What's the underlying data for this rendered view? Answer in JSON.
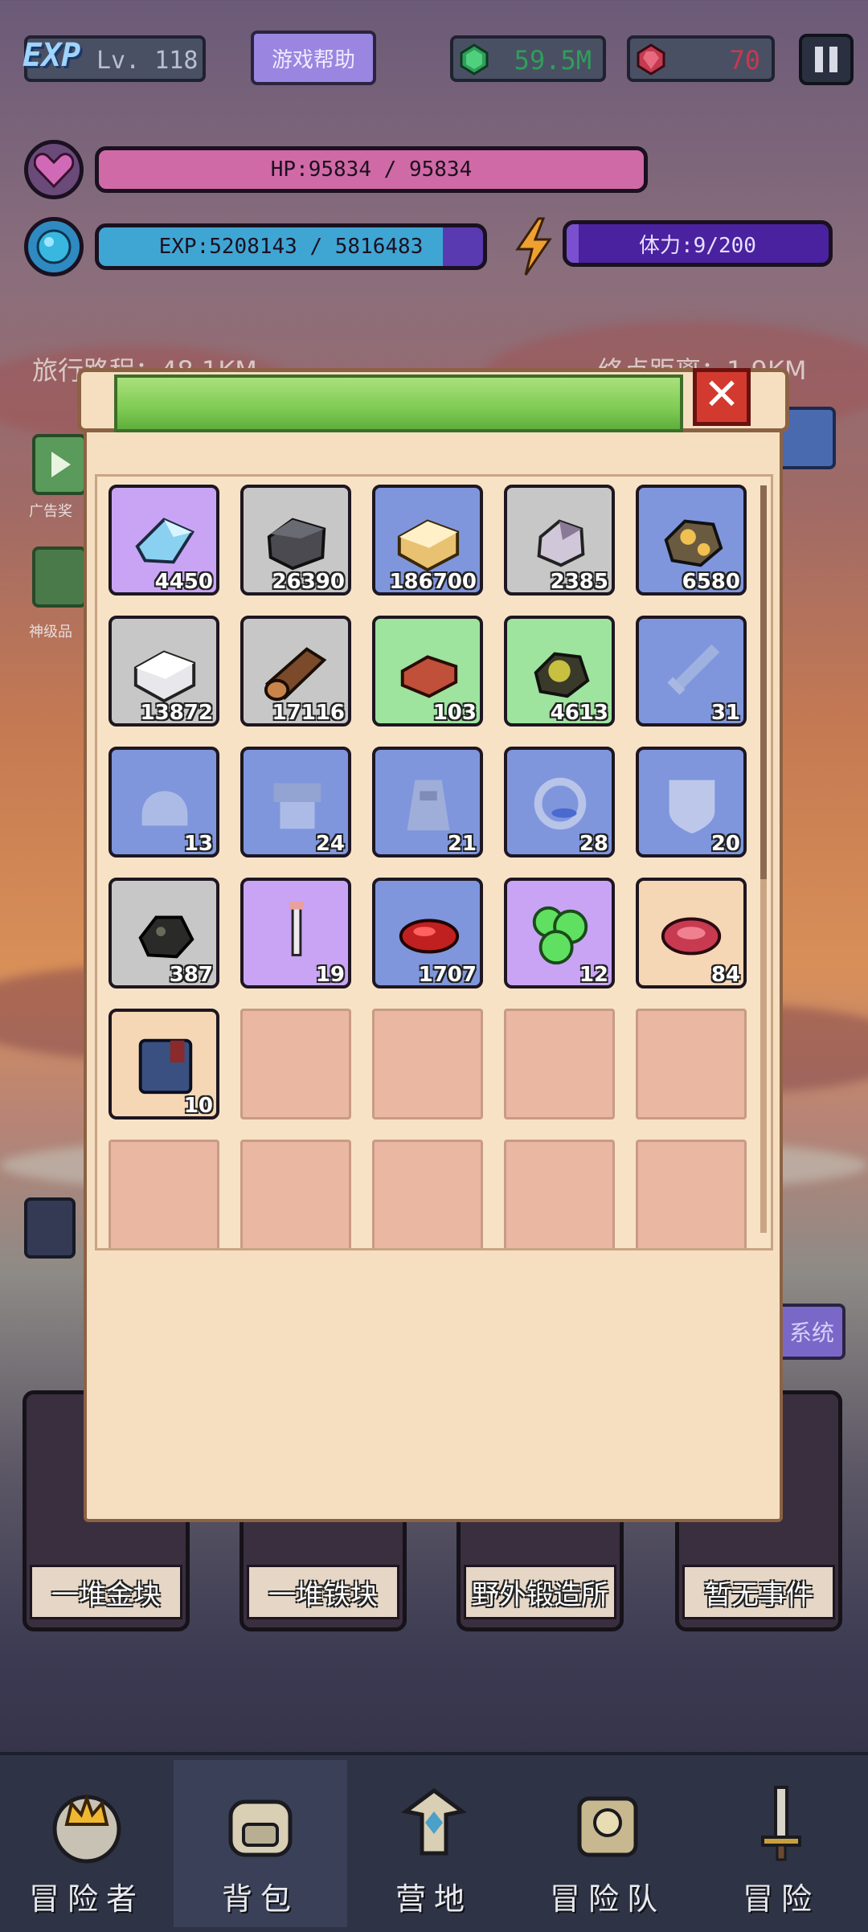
{
  "header": {
    "exp_logo": "EXP",
    "level": "Lv. 118",
    "help_button": "游戏帮助",
    "currency_green": "59.5M",
    "currency_red": "70",
    "green_color": "#2f9e5a",
    "red_color": "#c43a4f"
  },
  "stats": {
    "hp_text": "HP:95834 / 95834",
    "hp_fraction": 1.0,
    "exp_text": "EXP:5208143 / 5816483",
    "exp_fraction": 0.895,
    "stamina_text": "体力:9/200",
    "stamina_fraction": 0.045
  },
  "background": {
    "travel_distance": "旅行路程：48.1KM",
    "end_distance": "终点距离：1.9KM",
    "ad_reward": "广告奖",
    "divine_item": "神级品",
    "system_button": "系统"
  },
  "inventory": {
    "title": "",
    "items": [
      {
        "icon": "crystal-icon",
        "count": "4450",
        "rarity": "#c9a4f5"
      },
      {
        "icon": "iron-ore-icon",
        "count": "26390",
        "rarity": "#c7c7c7"
      },
      {
        "icon": "gold-ingot-icon",
        "count": "186700",
        "rarity": "#7f96dd"
      },
      {
        "icon": "silver-ore-icon",
        "count": "2385",
        "rarity": "#c7c7c7"
      },
      {
        "icon": "gold-ore-icon",
        "count": "6580",
        "rarity": "#7f96dd"
      },
      {
        "icon": "stone-block-icon",
        "count": "13872",
        "rarity": "#c7c7c7"
      },
      {
        "icon": "wood-log-icon",
        "count": "17116",
        "rarity": "#c7c7c7"
      },
      {
        "icon": "brick-icon",
        "count": "103",
        "rarity": "#9ee39e"
      },
      {
        "icon": "sulfur-ore-icon",
        "count": "4613",
        "rarity": "#9ee39e"
      },
      {
        "icon": "sword-blueprint-icon",
        "count": "31",
        "rarity": "#7f96dd"
      },
      {
        "icon": "helmet-blueprint-icon",
        "count": "13",
        "rarity": "#7f96dd"
      },
      {
        "icon": "armor-blueprint-icon",
        "count": "24",
        "rarity": "#7f96dd"
      },
      {
        "icon": "robe-blueprint-icon",
        "count": "21",
        "rarity": "#7f96dd"
      },
      {
        "icon": "ring-blueprint-icon",
        "count": "28",
        "rarity": "#7f96dd"
      },
      {
        "icon": "shield-blueprint-icon",
        "count": "20",
        "rarity": "#7f96dd"
      },
      {
        "icon": "coal-icon",
        "count": "387",
        "rarity": "#c7c7c7"
      },
      {
        "icon": "wand-icon",
        "count": "19",
        "rarity": "#c9a4f5"
      },
      {
        "icon": "red-lens-icon",
        "count": "1707",
        "rarity": "#7f96dd"
      },
      {
        "icon": "slime-icon",
        "count": "12",
        "rarity": "#c9a4f5"
      },
      {
        "icon": "meat-icon",
        "count": "84",
        "rarity": "#f5d7b6"
      },
      {
        "icon": "book-icon",
        "count": "10",
        "rarity": "#f5d7b6"
      }
    ],
    "empty_slots": 9
  },
  "events": [
    {
      "label": "一堆金块"
    },
    {
      "label": "一堆铁块"
    },
    {
      "label": "野外锻造所"
    },
    {
      "label": "暂无事件"
    }
  ],
  "nav": [
    {
      "label": "冒险者",
      "icon": "crown-icon"
    },
    {
      "label": "背包",
      "icon": "backpack-icon"
    },
    {
      "label": "营地",
      "icon": "camp-icon"
    },
    {
      "label": "冒险队",
      "icon": "team-icon"
    },
    {
      "label": "冒险",
      "icon": "sword-icon"
    }
  ]
}
